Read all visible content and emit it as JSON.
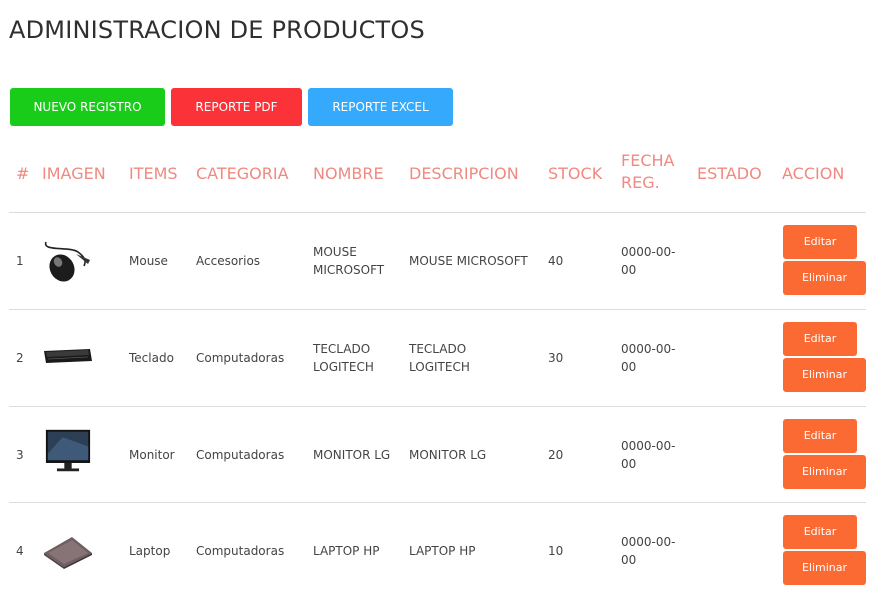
{
  "page": {
    "title": "ADMINISTRACION DE PRODUCTOS"
  },
  "toolbar": {
    "new_label": "NUEVO REGISTRO",
    "pdf_label": "REPORTE PDF",
    "excel_label": "REPORTE EXCEL"
  },
  "colors": {
    "new": "#19cc19",
    "pdf": "#fb3338",
    "excel": "#35a9fb",
    "action": "#fb6a33",
    "header_text": "#f08980"
  },
  "table": {
    "headers": {
      "num": "#",
      "image": "IMAGEN",
      "items": "ITEMS",
      "category": "CATEGORIA",
      "name": "NOMBRE",
      "description": "DESCRIPCION",
      "stock": "STOCK",
      "date_line1": "FECHA",
      "date_line2": "REG.",
      "status": "ESTADO",
      "action": "ACCION"
    },
    "rows": [
      {
        "num": "1",
        "image": "mouse-image",
        "item": "Mouse",
        "category": "Accesorios",
        "name_line1": "MOUSE",
        "name_line2": "MICROSOFT",
        "description": "MOUSE MICROSOFT",
        "stock": "40",
        "date_line1": "0000-00-",
        "date_line2": "00",
        "status": "",
        "edit_label": "Editar",
        "delete_label": "Eliminar"
      },
      {
        "num": "2",
        "image": "keyboard-image",
        "item": "Teclado",
        "category": "Computadoras",
        "name_line1": "TECLADO",
        "name_line2": "LOGITECH",
        "description_line1": "TECLADO",
        "description_line2": "LOGITECH",
        "stock": "30",
        "date_line1": "0000-00-",
        "date_line2": "00",
        "status": "",
        "edit_label": "Editar",
        "delete_label": "Eliminar"
      },
      {
        "num": "3",
        "image": "monitor-image",
        "item": "Monitor",
        "category": "Computadoras",
        "name": "MONITOR LG",
        "description": "MONITOR LG",
        "stock": "20",
        "date_line1": "0000-00-",
        "date_line2": "00",
        "status": "",
        "edit_label": "Editar",
        "delete_label": "Eliminar"
      },
      {
        "num": "4",
        "image": "laptop-image",
        "item": "Laptop",
        "category": "Computadoras",
        "name": "LAPTOP HP",
        "description": "LAPTOP HP",
        "stock": "10",
        "date_line1": "0000-00-",
        "date_line2": "00",
        "status": "",
        "edit_label": "Editar",
        "delete_label": "Eliminar"
      }
    ]
  }
}
